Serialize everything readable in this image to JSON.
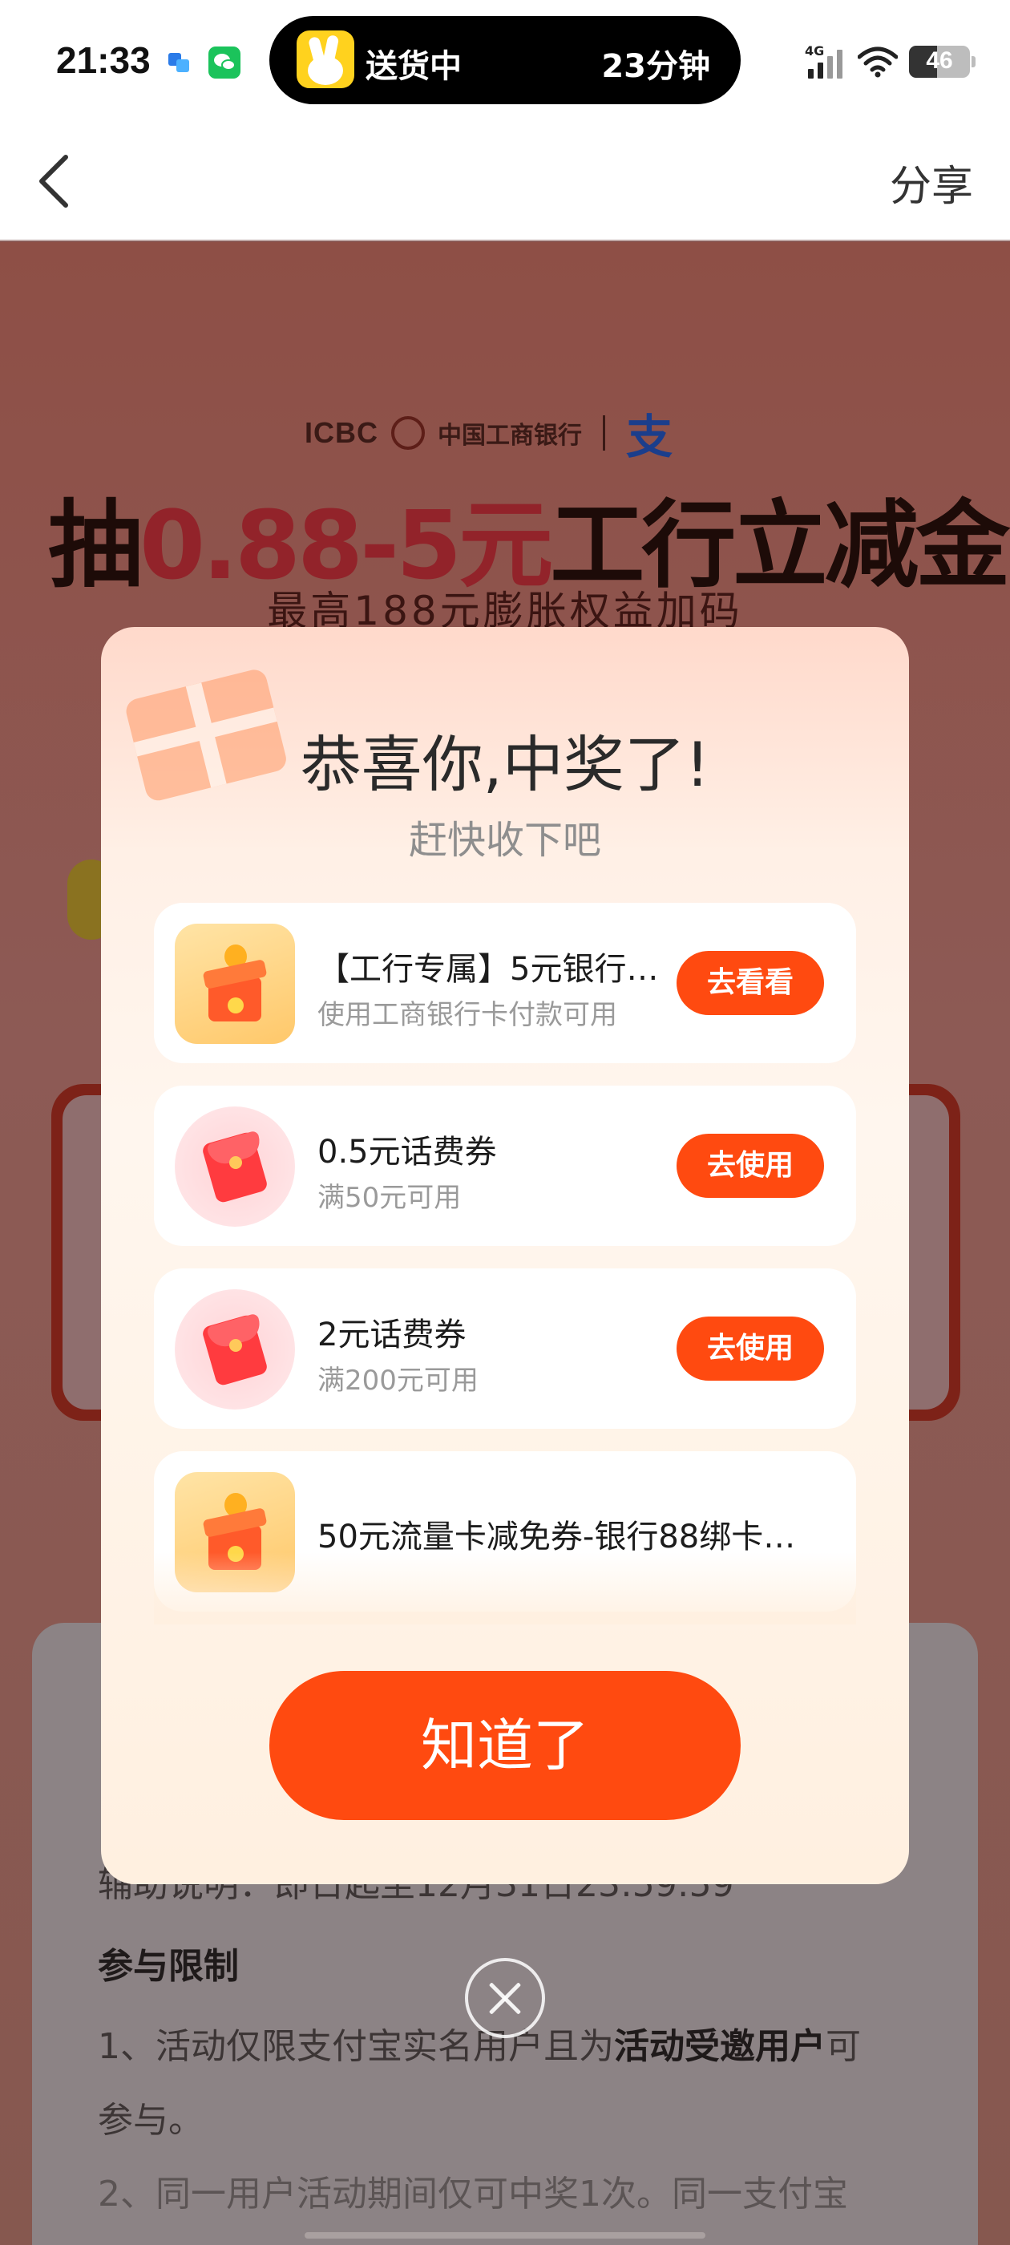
{
  "status_bar": {
    "time": "21:33",
    "island_text": "送货中",
    "island_eta": "23分钟",
    "network": "4G",
    "battery": "46",
    "battery_level": 0.46
  },
  "nav": {
    "share_label": "分享"
  },
  "background": {
    "icbc_text": "ICBC",
    "bank_name": "中国工商银行",
    "alipay_mark": "支",
    "headline_pre": "抽",
    "headline_red": "0.88-5元",
    "headline_post": "工行立减金",
    "subline": "最高188元膨胀权益加码",
    "rules": {
      "line1": "辅助说明：即日起至12月31日23:59:59",
      "heading": "参与限制",
      "line2_a": "1、活动仅限支付宝实名用户且为",
      "line2_b": "活动受邀用户",
      "line2_c": "可",
      "line3": "参与。",
      "line4": "2、同一用户活动期间仅可中奖1次。同一支付宝"
    }
  },
  "modal": {
    "title": "恭喜你,中奖了!",
    "subtitle": "赶快收下吧",
    "prizes": [
      {
        "icon": "gift-box-icon",
        "title": "【工行专属】5元银行…",
        "desc": "使用工商银行卡付款可用",
        "button": "去看看"
      },
      {
        "icon": "red-envelope-icon",
        "title": "0.5元话费券",
        "desc": "满50元可用",
        "button": "去使用"
      },
      {
        "icon": "red-envelope-icon",
        "title": "2元话费券",
        "desc": "满200元可用",
        "button": "去使用"
      },
      {
        "icon": "gift-box-icon",
        "title": "50元流量卡减免券-银行88绑卡…",
        "desc": "",
        "button": ""
      }
    ],
    "ok_button": "知道了"
  },
  "colors": {
    "accent": "#ff4a10",
    "overlay_bg": "#8a5a55"
  }
}
